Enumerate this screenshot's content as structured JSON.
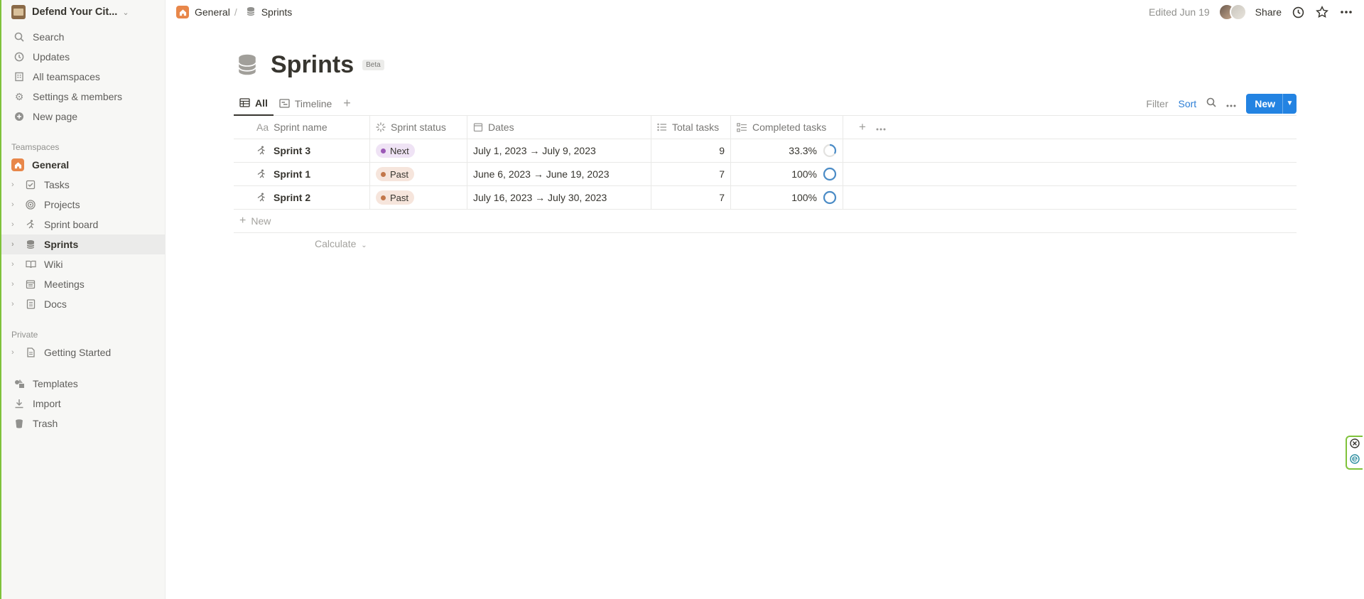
{
  "workspace": {
    "name": "Defend Your Cit...",
    "chevron_icon": "chevron-updown-icon"
  },
  "sidebar": {
    "top_items": [
      {
        "label": "Search",
        "icon": "search-icon"
      },
      {
        "label": "Updates",
        "icon": "clock-icon"
      },
      {
        "label": "All teamspaces",
        "icon": "building-icon"
      },
      {
        "label": "Settings & members",
        "icon": "gear-icon"
      },
      {
        "label": "New page",
        "icon": "plus-circle-icon"
      }
    ],
    "teamspaces_label": "Teamspaces",
    "general_label": "General",
    "tree": [
      {
        "label": "Tasks",
        "icon": "checkbox-icon"
      },
      {
        "label": "Projects",
        "icon": "target-icon"
      },
      {
        "label": "Sprint board",
        "icon": "running-icon"
      },
      {
        "label": "Sprints",
        "icon": "database-icon",
        "active": true
      },
      {
        "label": "Wiki",
        "icon": "book-icon"
      },
      {
        "label": "Meetings",
        "icon": "calendar-icon"
      },
      {
        "label": "Docs",
        "icon": "doc-icon"
      }
    ],
    "private_label": "Private",
    "private_items": [
      {
        "label": "Getting Started",
        "icon": "page-icon"
      }
    ],
    "bottom_items": [
      {
        "label": "Templates",
        "icon": "templates-icon"
      },
      {
        "label": "Import",
        "icon": "download-icon"
      },
      {
        "label": "Trash",
        "icon": "trash-icon"
      }
    ]
  },
  "topbar": {
    "breadcrumb": {
      "parent": "General",
      "separator": "/",
      "current": "Sprints"
    },
    "edited": "Edited Jun 19",
    "share": "Share"
  },
  "page": {
    "title": "Sprints",
    "badge": "Beta",
    "views": [
      {
        "label": "All",
        "active": true
      },
      {
        "label": "Timeline",
        "active": false
      }
    ],
    "toolbar": {
      "filter": "Filter",
      "sort": "Sort",
      "new": "New"
    }
  },
  "table": {
    "columns": [
      {
        "label": "Sprint name",
        "icon_text": "Aa"
      },
      {
        "label": "Sprint status",
        "icon": "status-icon"
      },
      {
        "label": "Dates",
        "icon": "calendar-icon"
      },
      {
        "label": "Total tasks",
        "icon": "list-icon"
      },
      {
        "label": "Completed tasks",
        "icon": "checklist-icon"
      }
    ],
    "rows": [
      {
        "name": "Sprint 3",
        "status": "Next",
        "status_color": "#9b59b6",
        "status_bg": "#efe3f5",
        "dates": "July 1, 2023 → July 9, 2023",
        "total": "9",
        "completed": "33.3%",
        "progress": 0.333
      },
      {
        "name": "Sprint 1",
        "status": "Past",
        "status_color": "#c2774a",
        "status_bg": "#f6e5dc",
        "dates": "June 6, 2023 → June 19, 2023",
        "total": "7",
        "completed": "100%",
        "progress": 1.0
      },
      {
        "name": "Sprint 2",
        "status": "Past",
        "status_color": "#c2774a",
        "status_bg": "#f6e5dc",
        "dates": "July 16, 2023 → July 30, 2023",
        "total": "7",
        "completed": "100%",
        "progress": 1.0
      }
    ],
    "new_row": "New",
    "calculate": "Calculate"
  },
  "colors": {
    "accent": "#2383e2",
    "ring": "#4b8cc7",
    "frame": "#7fc23a"
  }
}
